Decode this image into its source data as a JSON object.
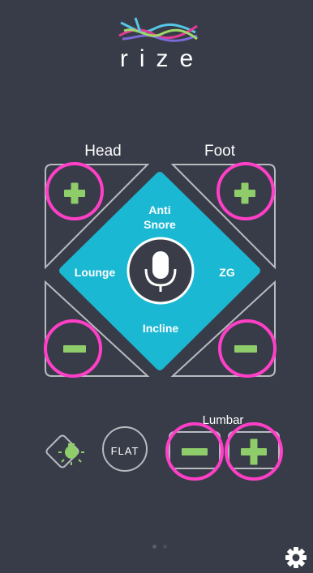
{
  "brand": {
    "name": "rize"
  },
  "columns": {
    "head": "Head",
    "foot": "Foot"
  },
  "positions": {
    "top": "Anti\nSnore",
    "left": "Lounge",
    "right": "ZG",
    "bottom": "Incline"
  },
  "lumbar": {
    "label": "Lumbar"
  },
  "flat": {
    "label": "FLAT"
  },
  "pager": {
    "count": 2,
    "active": 0
  },
  "colors": {
    "background": "#383c48",
    "accent": "#1bb8d3",
    "highlight": "#ff3fc7",
    "plus_minus": "#8fcd6a",
    "outline": "#b8bac0"
  },
  "icons": {
    "logo": "rize-wave-logo",
    "mic": "microphone-icon",
    "light": "lightbulb-icon",
    "settings": "gear-icon"
  }
}
